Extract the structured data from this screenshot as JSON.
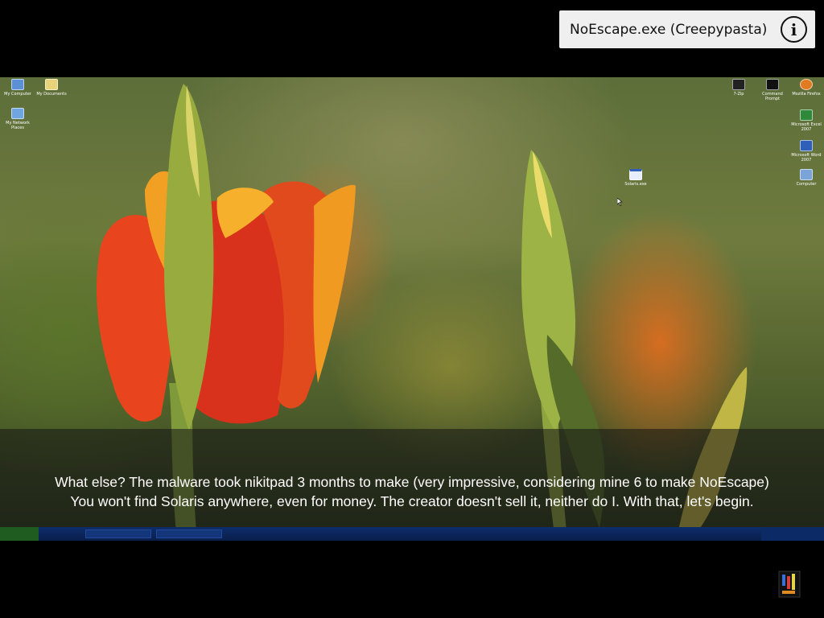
{
  "video": {
    "title": "NoEscape.exe (Creepypasta)",
    "info_icon": "info-icon"
  },
  "desktop": {
    "icons_left": [
      {
        "label": "My Computer",
        "icon": "computer-icon"
      },
      {
        "label": "My Documents",
        "icon": "folder-icon"
      },
      {
        "label": "My Network Places",
        "icon": "network-icon"
      }
    ],
    "icons_right": [
      {
        "label": "7-Zip",
        "icon": "archive-icon"
      },
      {
        "label": "Command Prompt",
        "icon": "terminal-icon"
      },
      {
        "label": "Mozilla Firefox",
        "icon": "firefox-icon"
      },
      {
        "label": "Microsoft Excel 2007",
        "icon": "excel-icon"
      },
      {
        "label": "Microsoft Word 2007",
        "icon": "word-icon"
      },
      {
        "label": "Computer",
        "icon": "computer-icon"
      }
    ],
    "center_icon": {
      "label": "Solaris.exe",
      "icon": "window-icon"
    }
  },
  "subtitles": {
    "line1": "What else? The malware took nikitpad 3 months to make (very impressive, considering mine 6 to make NoEscape)",
    "line2": "You won't find Solaris anywhere, even for money. The creator doesn't sell it, neither do I. With that, let's begin."
  },
  "colors": {
    "title_chip_bg": "#efefef",
    "taskbar": "#0d2d6b",
    "tulip_red": "#d8321c",
    "tulip_orange": "#f0961c"
  }
}
